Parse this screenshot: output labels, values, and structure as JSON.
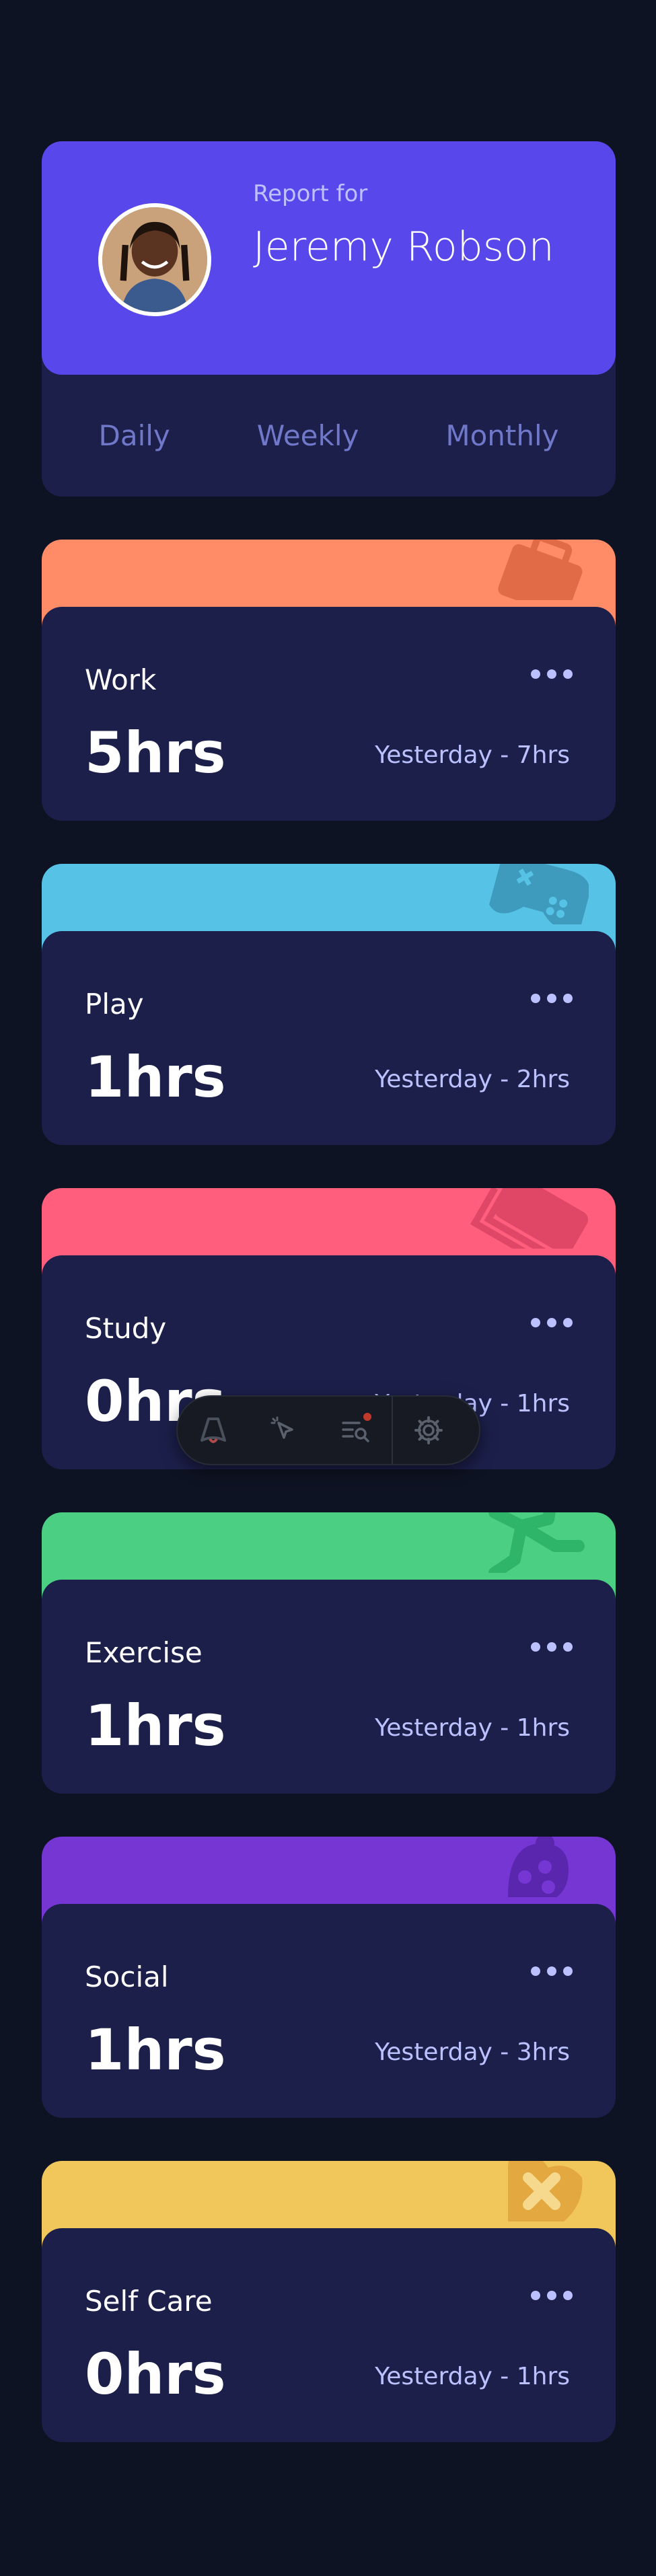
{
  "profile": {
    "report_label": "Report for",
    "name": "Jeremy Robson",
    "avatar_icon": "user-avatar-photo",
    "tabs": [
      {
        "label": "Daily"
      },
      {
        "label": "Weekly"
      },
      {
        "label": "Monthly"
      }
    ]
  },
  "activities": [
    {
      "title": "Work",
      "hours": "5hrs",
      "previous": "Yesterday - 7hrs",
      "color": "#ff8c66",
      "icon": "briefcase-icon"
    },
    {
      "title": "Play",
      "hours": "1hrs",
      "previous": "Yesterday - 2hrs",
      "color": "#56c2e6",
      "icon": "gamepad-icon"
    },
    {
      "title": "Study",
      "hours": "0hrs",
      "previous": "Yesterday - 1hrs",
      "color": "#ff5e7d",
      "icon": "book-icon"
    },
    {
      "title": "Exercise",
      "hours": "1hrs",
      "previous": "Yesterday - 1hrs",
      "color": "#4bcf83",
      "icon": "running-person-icon"
    },
    {
      "title": "Social",
      "hours": "1hrs",
      "previous": "Yesterday - 3hrs",
      "color": "#7536d3",
      "icon": "social-icon"
    },
    {
      "title": "Self Care",
      "hours": "0hrs",
      "previous": "Yesterday - 1hrs",
      "color": "#f1c75b",
      "icon": "heart-plus-icon"
    }
  ],
  "toolbar": {
    "tools": [
      "astro-logo-icon",
      "pointer-select-icon",
      "search-list-icon",
      "gear-icon"
    ],
    "notification_color": "#c0392b"
  }
}
